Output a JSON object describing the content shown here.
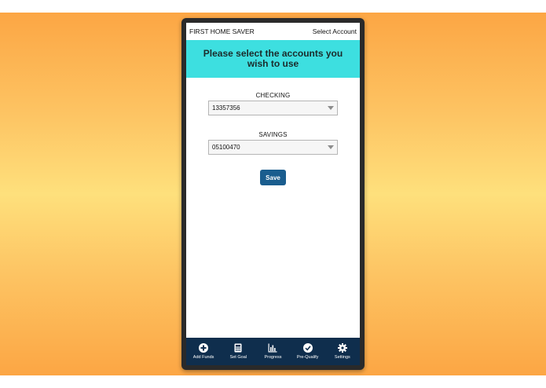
{
  "app": {
    "title": "FIRST HOME SAVER",
    "select_account": "Select Account"
  },
  "banner": {
    "text": "Please select the accounts you wish to use"
  },
  "checking": {
    "label": "CHECKING",
    "value": "13357356"
  },
  "savings": {
    "label": "SAVINGS",
    "value": "05100470"
  },
  "save_button": {
    "label": "Save"
  },
  "nav": {
    "items": [
      {
        "label": "Add Funds",
        "icon": "plus-circle-icon"
      },
      {
        "label": "Set Goal",
        "icon": "calculator-icon"
      },
      {
        "label": "Progress",
        "icon": "bar-chart-icon"
      },
      {
        "label": "Pre-Qualify",
        "icon": "check-circle-icon"
      },
      {
        "label": "Settings",
        "icon": "gear-icon"
      }
    ]
  },
  "colors": {
    "banner": "#3ddfe0",
    "save_button": "#1a5d8e",
    "navbar": "#0f2e4d",
    "background_orange": "#fca644",
    "background_yellow": "#fee07c"
  }
}
